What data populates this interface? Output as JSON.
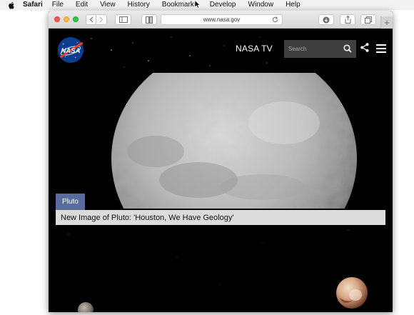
{
  "menubar": {
    "apple_icon": "apple-icon",
    "items": [
      "Safari",
      "File",
      "Edit",
      "View",
      "History",
      "Bookmarks",
      "Develop",
      "Window",
      "Help"
    ]
  },
  "browser": {
    "url": "www.nasa.gov",
    "new_tab": "+"
  },
  "nasa": {
    "logo_text": "NASA",
    "nav_tv": "NASA TV",
    "search_placeholder": "Search"
  },
  "feature": {
    "tag": "Pluto",
    "headline": "New Image of Pluto: 'Houston, We Have Geology'"
  },
  "colors": {
    "accent_tag": "#5a6c9e",
    "page_background": "#000000",
    "search_background": "#3f3f3f"
  }
}
